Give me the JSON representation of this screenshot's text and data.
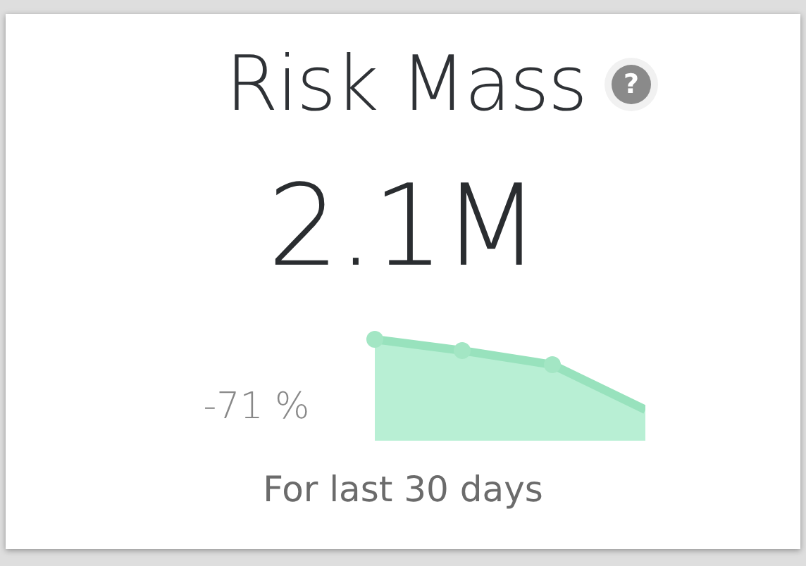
{
  "card": {
    "title": "Risk Mass",
    "help_icon": "?",
    "value": "2.1M",
    "change": "-71 %",
    "period": "For last 30 days"
  }
}
